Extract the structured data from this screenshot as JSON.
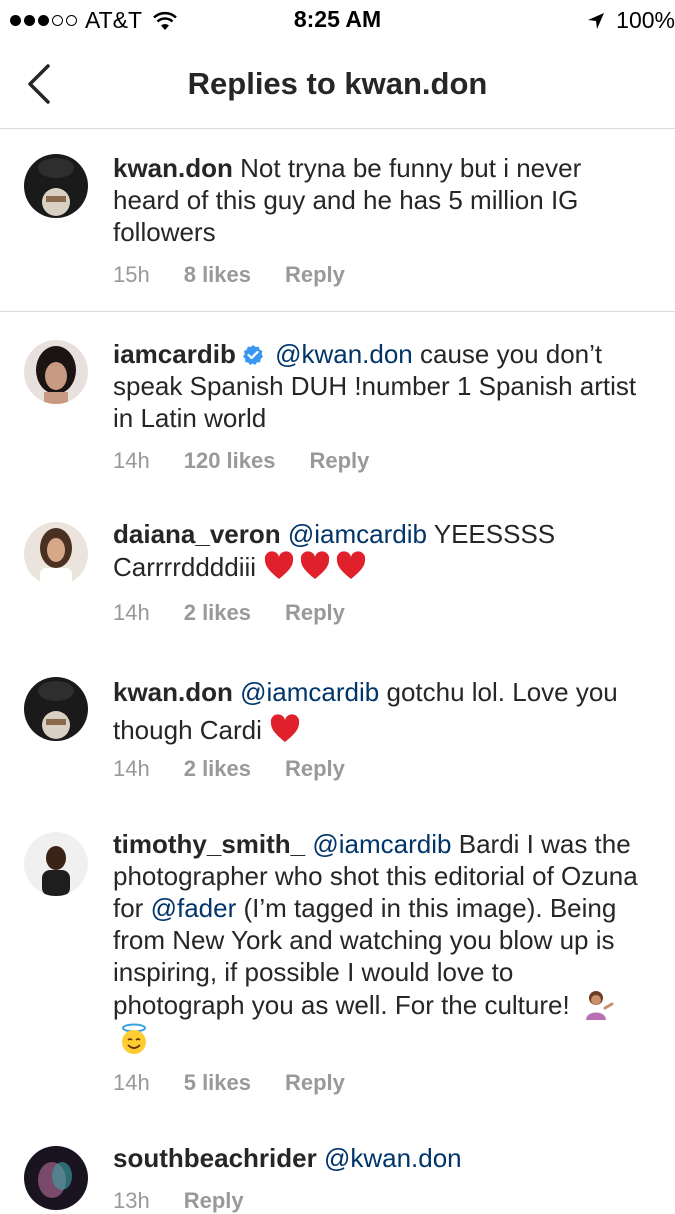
{
  "status_bar": {
    "carrier": "AT&T",
    "time": "8:25 AM",
    "battery": "100%"
  },
  "nav": {
    "title": "Replies to kwan.don"
  },
  "comments": [
    {
      "user": "kwan.don",
      "text": "Not tryna be funny but i never heard of this guy and he has 5 million IG followers",
      "time": "15h",
      "likes": "8 likes",
      "reply": "Reply"
    },
    {
      "user": "iamcardib",
      "verified": true,
      "mention": "@kwan.don",
      "text": "cause you don’t speak Spanish DUH !number 1 Spanish artist in Latin world",
      "time": "14h",
      "likes": "120 likes",
      "reply": "Reply"
    },
    {
      "user": "daiana_veron",
      "mention": "@iamcardib",
      "text": "YEESSSS Carrrrddddiii",
      "emojis": [
        "red-heart",
        "red-heart",
        "red-heart"
      ],
      "time": "14h",
      "likes": "2 likes",
      "reply": "Reply"
    },
    {
      "user": "kwan.don",
      "mention": "@iamcardib",
      "text": "gotchu lol. Love you though Cardi",
      "emojis": [
        "red-heart"
      ],
      "time": "14h",
      "likes": "2 likes",
      "reply": "Reply"
    },
    {
      "user": "timothy_smith_",
      "mention": "@iamcardib",
      "text_a": "Bardi I was the photographer who shot this editorial of Ozuna for",
      "mention2": "@fader",
      "text_b": "(I’m tagged in this image). Being from New York and watching you blow up is inspiring, if possible I would love to photograph you as well. For the culture!",
      "emojis": [
        "woman-tipping-hand",
        "smiling-face-with-halo"
      ],
      "time": "14h",
      "likes": "5 likes",
      "reply": "Reply"
    },
    {
      "user": "southbeachrider",
      "mention": "@kwan.don",
      "time": "13h",
      "reply": "Reply"
    }
  ]
}
